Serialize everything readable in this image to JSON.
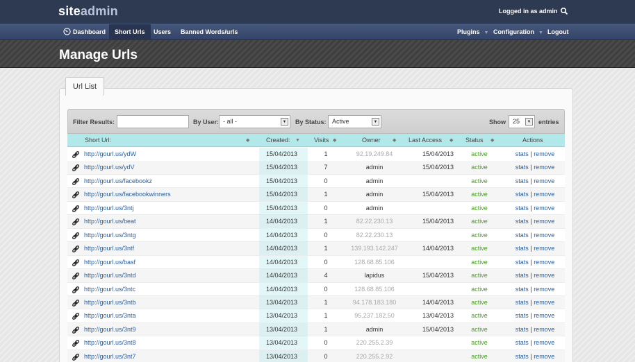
{
  "header": {
    "logo_part1": "site",
    "logo_part2": "admin",
    "logged_in_text": "Logged in as admin",
    "search_icon": "search-icon"
  },
  "nav": {
    "left": [
      {
        "label": "Dashboard",
        "icon": "dashboard-icon",
        "active": false
      },
      {
        "label": "Short Urls",
        "active": true
      },
      {
        "label": "Users",
        "active": false
      },
      {
        "label": "Banned Words/urls",
        "active": false
      }
    ],
    "right": [
      {
        "label": "Plugins",
        "has_caret": true
      },
      {
        "label": "Configuration",
        "has_caret": true
      },
      {
        "label": "Logout",
        "has_caret": false
      }
    ]
  },
  "page_title": "Manage Urls",
  "tab_label": "Url List",
  "filters": {
    "filter_label": "Filter Results:",
    "filter_value": "",
    "by_user_label": "By User:",
    "by_user_value": "- all -",
    "by_status_label": "By Status:",
    "by_status_value": "Active",
    "show_label": "Show",
    "show_value": "25",
    "entries_label": "entries"
  },
  "table": {
    "headers": {
      "short_url": "Short Url:",
      "created": "Created:",
      "visits": "Visits",
      "owner": "Owner",
      "last_access": "Last Access",
      "status": "Status",
      "actions": "Actions"
    },
    "stats_label": "stats",
    "separator": "|",
    "remove_label": "remove",
    "rows": [
      {
        "url": "http://gourl.us/ydW",
        "created": "15/04/2013",
        "visits": "1",
        "owner": "92.19.249.84",
        "owner_is_ip": true,
        "last_access": "15/04/2013",
        "status": "active"
      },
      {
        "url": "http://gourl.us/ydV",
        "created": "15/04/2013",
        "visits": "7",
        "owner": "admin",
        "owner_is_ip": false,
        "last_access": "15/04/2013",
        "status": "active"
      },
      {
        "url": "http://gourl.us/facebookz",
        "created": "15/04/2013",
        "visits": "0",
        "owner": "admin",
        "owner_is_ip": false,
        "last_access": "",
        "status": "active"
      },
      {
        "url": "http://gourl.us/facebookwinners",
        "created": "15/04/2013",
        "visits": "1",
        "owner": "admin",
        "owner_is_ip": false,
        "last_access": "15/04/2013",
        "status": "active"
      },
      {
        "url": "http://gourl.us/3ntj",
        "created": "15/04/2013",
        "visits": "0",
        "owner": "admin",
        "owner_is_ip": false,
        "last_access": "",
        "status": "active"
      },
      {
        "url": "http://gourl.us/beat",
        "created": "14/04/2013",
        "visits": "1",
        "owner": "82.22.230.13",
        "owner_is_ip": true,
        "last_access": "15/04/2013",
        "status": "active"
      },
      {
        "url": "http://gourl.us/3ntg",
        "created": "14/04/2013",
        "visits": "0",
        "owner": "82.22.230.13",
        "owner_is_ip": true,
        "last_access": "",
        "status": "active"
      },
      {
        "url": "http://gourl.us/3ntf",
        "created": "14/04/2013",
        "visits": "1",
        "owner": "139.193.142.247",
        "owner_is_ip": true,
        "last_access": "14/04/2013",
        "status": "active"
      },
      {
        "url": "http://gourl.us/basf",
        "created": "14/04/2013",
        "visits": "0",
        "owner": "128.68.85.106",
        "owner_is_ip": true,
        "last_access": "",
        "status": "active"
      },
      {
        "url": "http://gourl.us/3ntd",
        "created": "14/04/2013",
        "visits": "4",
        "owner": "lapidus",
        "owner_is_ip": false,
        "last_access": "15/04/2013",
        "status": "active"
      },
      {
        "url": "http://gourl.us/3ntc",
        "created": "14/04/2013",
        "visits": "0",
        "owner": "128.68.85.106",
        "owner_is_ip": true,
        "last_access": "",
        "status": "active"
      },
      {
        "url": "http://gourl.us/3ntb",
        "created": "13/04/2013",
        "visits": "1",
        "owner": "94.178.183.180",
        "owner_is_ip": true,
        "last_access": "14/04/2013",
        "status": "active"
      },
      {
        "url": "http://gourl.us/3nta",
        "created": "13/04/2013",
        "visits": "1",
        "owner": "95.237.182.50",
        "owner_is_ip": true,
        "last_access": "13/04/2013",
        "status": "active"
      },
      {
        "url": "http://gourl.us/3nt9",
        "created": "13/04/2013",
        "visits": "1",
        "owner": "admin",
        "owner_is_ip": false,
        "last_access": "15/04/2013",
        "status": "active"
      },
      {
        "url": "http://gourl.us/3nt8",
        "created": "13/04/2013",
        "visits": "0",
        "owner": "220.255.2.39",
        "owner_is_ip": true,
        "last_access": "",
        "status": "active"
      },
      {
        "url": "http://gourl.us/3nt7",
        "created": "13/04/2013",
        "visits": "0",
        "owner": "220.255.2.92",
        "owner_is_ip": true,
        "last_access": "",
        "status": "active"
      }
    ]
  },
  "colors": {
    "topbar": "#2e3a52",
    "navbar": "#3d4e72",
    "table_header": "#b2e8ea",
    "link": "#2a5d9a",
    "status_active": "#4a9a22"
  }
}
